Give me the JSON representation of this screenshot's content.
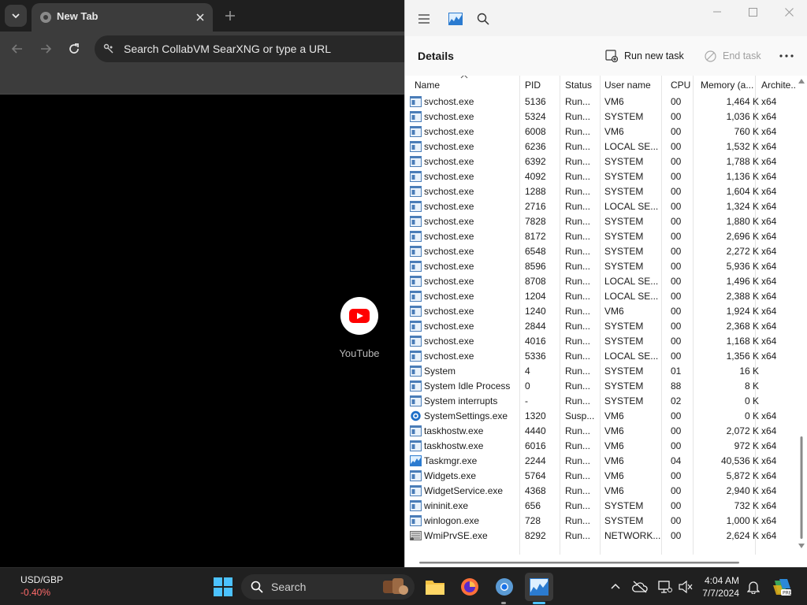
{
  "browser": {
    "tab_title": "New Tab",
    "omnibox_placeholder": "Search CollabVM SearXNG or type a URL",
    "shortcut_label": "YouTube"
  },
  "task_manager": {
    "heading": "Details",
    "run_new_task": "Run new task",
    "end_task": "End task",
    "columns": [
      "Name",
      "PID",
      "Status",
      "User name",
      "CPU",
      "Memory (a...",
      "Archite..."
    ],
    "rows": [
      {
        "icon": "process-icon",
        "name": "svchost.exe",
        "pid": "5136",
        "status": "Run...",
        "user": "VM6",
        "cpu": "00",
        "mem": "1,464 K",
        "arch": "x64"
      },
      {
        "icon": "process-icon",
        "name": "svchost.exe",
        "pid": "5324",
        "status": "Run...",
        "user": "SYSTEM",
        "cpu": "00",
        "mem": "1,036 K",
        "arch": "x64"
      },
      {
        "icon": "process-icon",
        "name": "svchost.exe",
        "pid": "6008",
        "status": "Run...",
        "user": "VM6",
        "cpu": "00",
        "mem": "760 K",
        "arch": "x64"
      },
      {
        "icon": "process-icon",
        "name": "svchost.exe",
        "pid": "6236",
        "status": "Run...",
        "user": "LOCAL SE...",
        "cpu": "00",
        "mem": "1,532 K",
        "arch": "x64"
      },
      {
        "icon": "process-icon",
        "name": "svchost.exe",
        "pid": "6392",
        "status": "Run...",
        "user": "SYSTEM",
        "cpu": "00",
        "mem": "1,788 K",
        "arch": "x64"
      },
      {
        "icon": "process-icon",
        "name": "svchost.exe",
        "pid": "4092",
        "status": "Run...",
        "user": "SYSTEM",
        "cpu": "00",
        "mem": "1,136 K",
        "arch": "x64"
      },
      {
        "icon": "process-icon",
        "name": "svchost.exe",
        "pid": "1288",
        "status": "Run...",
        "user": "SYSTEM",
        "cpu": "00",
        "mem": "1,604 K",
        "arch": "x64"
      },
      {
        "icon": "process-icon",
        "name": "svchost.exe",
        "pid": "2716",
        "status": "Run...",
        "user": "LOCAL SE...",
        "cpu": "00",
        "mem": "1,324 K",
        "arch": "x64"
      },
      {
        "icon": "process-icon",
        "name": "svchost.exe",
        "pid": "7828",
        "status": "Run...",
        "user": "SYSTEM",
        "cpu": "00",
        "mem": "1,880 K",
        "arch": "x64"
      },
      {
        "icon": "process-icon",
        "name": "svchost.exe",
        "pid": "8172",
        "status": "Run...",
        "user": "SYSTEM",
        "cpu": "00",
        "mem": "2,696 K",
        "arch": "x64"
      },
      {
        "icon": "process-icon",
        "name": "svchost.exe",
        "pid": "6548",
        "status": "Run...",
        "user": "SYSTEM",
        "cpu": "00",
        "mem": "2,272 K",
        "arch": "x64"
      },
      {
        "icon": "process-icon",
        "name": "svchost.exe",
        "pid": "8596",
        "status": "Run...",
        "user": "SYSTEM",
        "cpu": "00",
        "mem": "5,936 K",
        "arch": "x64"
      },
      {
        "icon": "process-icon",
        "name": "svchost.exe",
        "pid": "8708",
        "status": "Run...",
        "user": "LOCAL SE...",
        "cpu": "00",
        "mem": "1,496 K",
        "arch": "x64"
      },
      {
        "icon": "process-icon",
        "name": "svchost.exe",
        "pid": "1204",
        "status": "Run...",
        "user": "LOCAL SE...",
        "cpu": "00",
        "mem": "2,388 K",
        "arch": "x64"
      },
      {
        "icon": "process-icon",
        "name": "svchost.exe",
        "pid": "1240",
        "status": "Run...",
        "user": "VM6",
        "cpu": "00",
        "mem": "1,924 K",
        "arch": "x64"
      },
      {
        "icon": "process-icon",
        "name": "svchost.exe",
        "pid": "2844",
        "status": "Run...",
        "user": "SYSTEM",
        "cpu": "00",
        "mem": "2,368 K",
        "arch": "x64"
      },
      {
        "icon": "process-icon",
        "name": "svchost.exe",
        "pid": "4016",
        "status": "Run...",
        "user": "SYSTEM",
        "cpu": "00",
        "mem": "1,168 K",
        "arch": "x64"
      },
      {
        "icon": "process-icon",
        "name": "svchost.exe",
        "pid": "5336",
        "status": "Run...",
        "user": "LOCAL SE...",
        "cpu": "00",
        "mem": "1,356 K",
        "arch": "x64"
      },
      {
        "icon": "process-icon",
        "name": "System",
        "pid": "4",
        "status": "Run...",
        "user": "SYSTEM",
        "cpu": "01",
        "mem": "16 K",
        "arch": ""
      },
      {
        "icon": "process-icon",
        "name": "System Idle Process",
        "pid": "0",
        "status": "Run...",
        "user": "SYSTEM",
        "cpu": "88",
        "mem": "8 K",
        "arch": ""
      },
      {
        "icon": "process-icon",
        "name": "System interrupts",
        "pid": "-",
        "status": "Run...",
        "user": "SYSTEM",
        "cpu": "02",
        "mem": "0 K",
        "arch": ""
      },
      {
        "icon": "settings-gear-icon",
        "name": "SystemSettings.exe",
        "pid": "1320",
        "status": "Susp...",
        "user": "VM6",
        "cpu": "00",
        "mem": "0 K",
        "arch": "x64"
      },
      {
        "icon": "process-icon",
        "name": "taskhostw.exe",
        "pid": "4440",
        "status": "Run...",
        "user": "VM6",
        "cpu": "00",
        "mem": "2,072 K",
        "arch": "x64"
      },
      {
        "icon": "process-icon",
        "name": "taskhostw.exe",
        "pid": "6016",
        "status": "Run...",
        "user": "VM6",
        "cpu": "00",
        "mem": "972 K",
        "arch": "x64"
      },
      {
        "icon": "task-manager-icon",
        "name": "Taskmgr.exe",
        "pid": "2244",
        "status": "Run...",
        "user": "VM6",
        "cpu": "04",
        "mem": "40,536 K",
        "arch": "x64"
      },
      {
        "icon": "process-icon",
        "name": "Widgets.exe",
        "pid": "5764",
        "status": "Run...",
        "user": "VM6",
        "cpu": "00",
        "mem": "5,872 K",
        "arch": "x64"
      },
      {
        "icon": "process-icon",
        "name": "WidgetService.exe",
        "pid": "4368",
        "status": "Run...",
        "user": "VM6",
        "cpu": "00",
        "mem": "2,940 K",
        "arch": "x64"
      },
      {
        "icon": "process-icon",
        "name": "wininit.exe",
        "pid": "656",
        "status": "Run...",
        "user": "SYSTEM",
        "cpu": "00",
        "mem": "732 K",
        "arch": "x64"
      },
      {
        "icon": "process-icon",
        "name": "winlogon.exe",
        "pid": "728",
        "status": "Run...",
        "user": "SYSTEM",
        "cpu": "00",
        "mem": "1,000 K",
        "arch": "x64"
      },
      {
        "icon": "wmi-provider-icon",
        "name": "WmiPrvSE.exe",
        "pid": "8292",
        "status": "Run...",
        "user": "NETWORK...",
        "cpu": "00",
        "mem": "2,624 K",
        "arch": "x64"
      }
    ]
  },
  "taskbar": {
    "ticker_symbol": "USD/GBP",
    "ticker_change": "-0.40%",
    "search_placeholder": "Search",
    "time": "4:04 AM",
    "date": "7/7/2024"
  },
  "colors": {
    "ticker_negative": "#ff6b6b",
    "accent": "#0067c0",
    "youtube_red": "#ff0000"
  }
}
